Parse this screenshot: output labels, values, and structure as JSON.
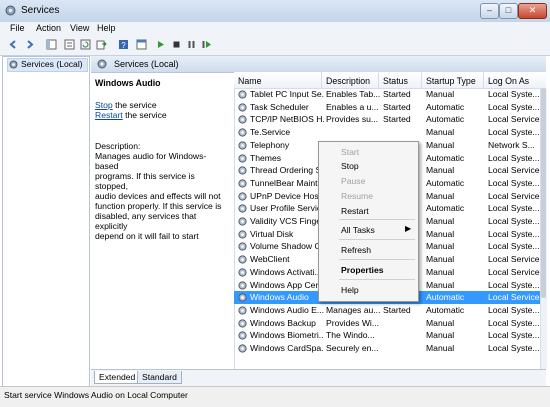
{
  "window": {
    "title": "Services"
  },
  "menu": [
    "File",
    "Action",
    "View",
    "Help"
  ],
  "toolbar": [
    "back-icon",
    "forward-icon",
    "show-hide-tree-icon",
    "properties-icon",
    "refresh-icon",
    "export-icon",
    "help-icon",
    "console-icon",
    "play-icon",
    "stop-icon",
    "pause-icon",
    "restart-icon"
  ],
  "tree": {
    "label": "Services (Local)"
  },
  "header": {
    "title": "Services (Local)"
  },
  "details": {
    "title": "Windows Audio",
    "stop_link": "Stop",
    "stop_rest": " the service",
    "restart_link": "Restart",
    "restart_rest": " the service",
    "desc_label": "Description:",
    "desc_text": "Manages audio for Windows-based\nprograms.  If this service is stopped,\naudio devices and effects will not\nfunction properly.  If this service is\ndisabled, any services that explicitly\ndepend on it will fail to start"
  },
  "columns": [
    "Name",
    "Description",
    "Status",
    "Startup Type",
    "Log On As"
  ],
  "rows": [
    [
      "Tablet PC Input Se...",
      "Enables Tab...",
      "Started",
      "Manual",
      "Local Syste..."
    ],
    [
      "Task Scheduler",
      "Enables a u...",
      "Started",
      "Automatic",
      "Local Syste..."
    ],
    [
      "TCP/IP NetBIOS H...",
      "Provides su...",
      "Started",
      "Automatic",
      "Local Service"
    ],
    [
      "Te.Service",
      "",
      "",
      "Manual",
      "Local Syste..."
    ],
    [
      "Telephony",
      "",
      "",
      "Manual",
      "Network S..."
    ],
    [
      "Themes",
      "",
      "",
      "Automatic",
      "Local Syste..."
    ],
    [
      "Thread Ordering S...",
      "",
      "",
      "Manual",
      "Local Service"
    ],
    [
      "TunnelBear Maint...",
      "",
      "",
      "Automatic",
      "Local Syste..."
    ],
    [
      "UPnP Device Host",
      "",
      "",
      "Manual",
      "Local Service"
    ],
    [
      "User Profile Service",
      "",
      "",
      "Automatic",
      "Local Syste..."
    ],
    [
      "Validity VCS Finge...",
      "",
      "",
      "Manual",
      "Local Syste..."
    ],
    [
      "Virtual Disk",
      "",
      "",
      "Manual",
      "Local Syste..."
    ],
    [
      "Volume Shadow C...",
      "",
      "",
      "Manual",
      "Local Syste..."
    ],
    [
      "WebClient",
      "",
      "",
      "Manual",
      "Local Service"
    ],
    [
      "Windows Activati...",
      "",
      "",
      "Manual",
      "Local Service"
    ],
    [
      "Windows App Cer...",
      "",
      "",
      "Manual",
      "Local Syste..."
    ],
    [
      "Windows Audio",
      "Manages au...",
      "Started",
      "Automatic",
      "Local Service"
    ],
    [
      "Windows Audio E...",
      "Manages au...",
      "Started",
      "Automatic",
      "Local Syste..."
    ],
    [
      "Windows Backup",
      "Provides Wi...",
      "",
      "Manual",
      "Local Syste..."
    ],
    [
      "Windows Biometri...",
      "The Windo...",
      "",
      "Manual",
      "Local Syste..."
    ],
    [
      "Windows CardSpa...",
      "Securely en...",
      "",
      "Manual",
      "Local Syste..."
    ]
  ],
  "selected_row": "Windows Audio",
  "context_menu": {
    "start": "Start",
    "stop": "Stop",
    "pause": "Pause",
    "resume": "Resume",
    "restart": "Restart",
    "all_tasks": "All Tasks",
    "refresh": "Refresh",
    "properties": "Properties",
    "help": "Help"
  },
  "tabs": [
    "Extended",
    "Standard"
  ],
  "status": "Start service Windows Audio on Local Computer",
  "colors": {
    "selection": "#3399ff",
    "link": "#0645ad",
    "titlebar": "#c3d5ea"
  }
}
